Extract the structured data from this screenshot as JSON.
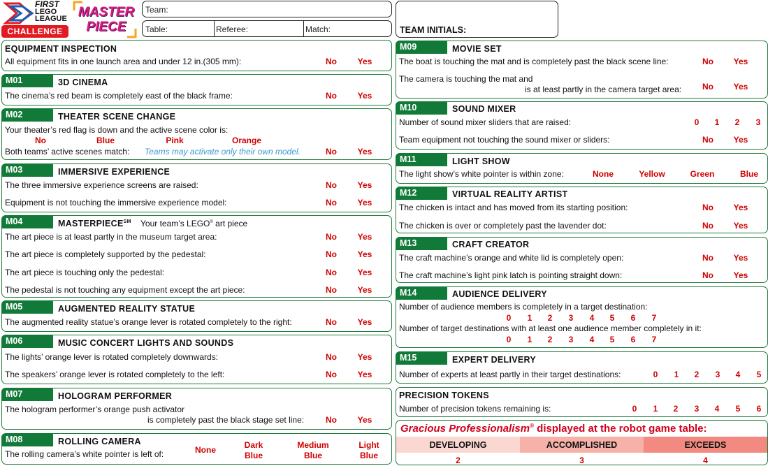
{
  "logo": {
    "first": "FIRST",
    "lego": "LEGO",
    "league": "LEAGUE",
    "challenge": "CHALLENGE",
    "masterpiece": "MASTER PIECE"
  },
  "header": {
    "team": "Team:",
    "table": "Table:",
    "referee": "Referee:",
    "match": "Match:",
    "initials": "TEAM INITIALS:"
  },
  "inspection": {
    "title": "EQUIPMENT INSPECTION",
    "line": "All equipment fits in one launch area and under 12 in.(305 mm):"
  },
  "yn": {
    "no": "No",
    "yes": "Yes"
  },
  "m01": {
    "code": "M01",
    "title": "3D CINEMA",
    "line": "The cinema’s red beam is completely east of the black frame:"
  },
  "m02": {
    "code": "M02",
    "title": "THEATER SCENE CHANGE",
    "line1": "Your theater’s red flag is down and the active scene color is:",
    "colors": [
      "No",
      "Blue",
      "Pink",
      "Orange"
    ],
    "line2": "Both teams’ active scenes match:",
    "note": "Teams may activate only their own model."
  },
  "m03": {
    "code": "M03",
    "title": "IMMERSIVE EXPERIENCE",
    "line1": "The three immersive experience screens are raised:",
    "line2": "Equipment is not touching the immersive experience model:"
  },
  "m04": {
    "code": "M04",
    "title": "MASTERPIECE",
    "sm": "SM",
    "subtitle": "Your team’s LEGO",
    "reg": "®",
    "subtitle2": " art piece",
    "lines": [
      "The art piece is at least partly in the museum target area:",
      "The art piece is completely supported by the pedestal:",
      "The art piece is touching only the pedestal:",
      "The pedestal is not touching any equipment except the art piece:"
    ]
  },
  "m05": {
    "code": "M05",
    "title": "AUGMENTED REALITY STATUE",
    "line": "The augmented reality statue’s orange lever is rotated completely to the right:"
  },
  "m06": {
    "code": "M06",
    "title": "MUSIC CONCERT LIGHTS AND SOUNDS",
    "line1": "The lights’ orange lever is rotated completely downwards:",
    "line2": "The speakers’ orange lever is rotated completely to the left:"
  },
  "m07": {
    "code": "M07",
    "title": "HOLOGRAM PERFORMER",
    "line1": "The hologram performer’s orange push activator",
    "line2": "is completely past the black stage set line:"
  },
  "m08": {
    "code": "M08",
    "title": "ROLLING CAMERA",
    "line": "The rolling camera’s white pointer is left of:",
    "opts": [
      {
        "a": "None",
        "b": ""
      },
      {
        "a": "Dark",
        "b": "Blue"
      },
      {
        "a": "Medium",
        "b": "Blue"
      },
      {
        "a": "Light",
        "b": "Blue"
      }
    ]
  },
  "m09": {
    "code": "M09",
    "title": "MOVIE SET",
    "line1": "The boat is touching the mat and is completely past the black scene line:",
    "line2a": "The camera is touching the mat and",
    "line2b": "is at least partly in the camera target area:"
  },
  "m10": {
    "code": "M10",
    "title": "SOUND MIXER",
    "line1": "Number of sound mixer sliders that are raised:",
    "nums": [
      "0",
      "1",
      "2",
      "3"
    ],
    "line2": "Team equipment not touching the sound mixer or sliders:"
  },
  "m11": {
    "code": "M11",
    "title": "LIGHT SHOW",
    "line": "The light show’s white pointer is within zone:",
    "opts": [
      "None",
      "Yellow",
      "Green",
      "Blue"
    ]
  },
  "m12": {
    "code": "M12",
    "title": "VIRTUAL REALITY ARTIST",
    "line1": "The chicken is intact and has moved from its starting position:",
    "line2": "The chicken is over or completely past the lavender dot:"
  },
  "m13": {
    "code": "M13",
    "title": "CRAFT CREATOR",
    "line1": "The craft machine’s orange and white lid is completely open:",
    "line2": "The craft machine’s light pink latch is pointing straight down:"
  },
  "m14": {
    "code": "M14",
    "title": "AUDIENCE DELIVERY",
    "line1": "Number of audience members is completely in a target destination:",
    "line2": "Number of target destinations with at least one audience member completely in it:",
    "nums": [
      "0",
      "1",
      "2",
      "3",
      "4",
      "5",
      "6",
      "7"
    ]
  },
  "m15": {
    "code": "M15",
    "title": "EXPERT DELIVERY",
    "line": "Number of experts at least partly in their target destinations:",
    "nums": [
      "0",
      "1",
      "2",
      "3",
      "4",
      "5"
    ]
  },
  "precision": {
    "title": "PRECISION TOKENS",
    "line": "Number of precision tokens remaining is:",
    "nums": [
      "0",
      "1",
      "2",
      "3",
      "4",
      "5",
      "6"
    ]
  },
  "gp": {
    "title": "Gracious Professionalism",
    "reg": "®",
    "title2": " displayed at the robot game table:",
    "levels": [
      {
        "label": "DEVELOPING",
        "value": "2"
      },
      {
        "label": "ACCOMPLISHED",
        "value": "3"
      },
      {
        "label": "EXCEEDS",
        "value": "4"
      }
    ]
  },
  "colors": {
    "green": "#117a38",
    "red": "#d00000",
    "dev": "#fbd7d2",
    "acc": "#f6b2a8",
    "exc": "#f28a82",
    "gp": "#d0021b"
  }
}
